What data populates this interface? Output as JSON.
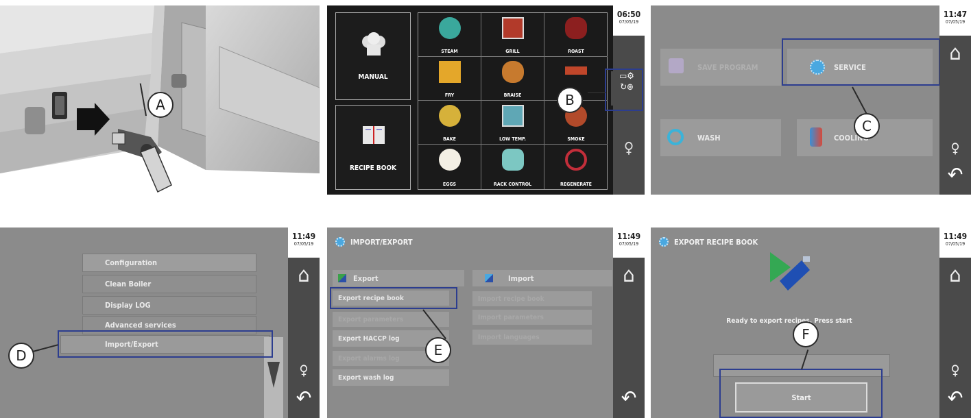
{
  "callouts": [
    "A",
    "B",
    "C",
    "D",
    "E",
    "F"
  ],
  "clocks": [
    {
      "time": "06:50",
      "date": "07/05/19"
    },
    {
      "time": "11:47",
      "date": "07/05/19"
    },
    {
      "time": "11:49",
      "date": "07/05/19"
    },
    {
      "time": "11:49",
      "date": "07/05/19"
    },
    {
      "time": "11:49",
      "date": "07/05/19"
    }
  ],
  "main_menu": {
    "manual": "MANUAL",
    "recipe_book": "RECIPE BOOK",
    "cells": [
      "STEAM",
      "GRILL",
      "ROAST",
      "FRY",
      "BRAISE",
      "BAKE",
      "LOW TEMP.",
      "SMOKE",
      "EGGS",
      "RACK CONTROL",
      "REGENERATE"
    ],
    "cell_colors": [
      "#3aa89c",
      "#b23a2a",
      "#8c1f1f",
      "#e4a72a",
      "#c77a2e",
      "#d6b13a",
      "#5fa7b5",
      "#b24a2a",
      "#e8c24a",
      "#7cc7c2",
      "#c22e3a"
    ]
  },
  "settings": {
    "save_program": "SAVE PROGRAM",
    "service": "SERVICE",
    "wash": "WASH",
    "cooling": "COOLING"
  },
  "service_menu": {
    "items": [
      "Configuration",
      "Clean Boiler",
      "Display LOG",
      "Advanced services",
      "Import/Export"
    ]
  },
  "import_export": {
    "title": "IMPORT/EXPORT",
    "export_header": "Export",
    "import_header": "Import",
    "export_items": [
      "Export recipe book",
      "Export parameters",
      "Export HACCP log",
      "Export alarms log",
      "Export wash log"
    ],
    "import_items": [
      "Import recipe book",
      "Import parameters",
      "Import languages"
    ]
  },
  "export_recipe": {
    "title": "EXPORT RECIPE BOOK",
    "message": "Ready to export recipes. Press start",
    "start": "Start"
  },
  "colors": {
    "panel_gray": "#8b8b8b",
    "sidebar": "#4a4a4a",
    "highlight": "#2c3d8f",
    "accent_blue": "#3b8fd6"
  }
}
